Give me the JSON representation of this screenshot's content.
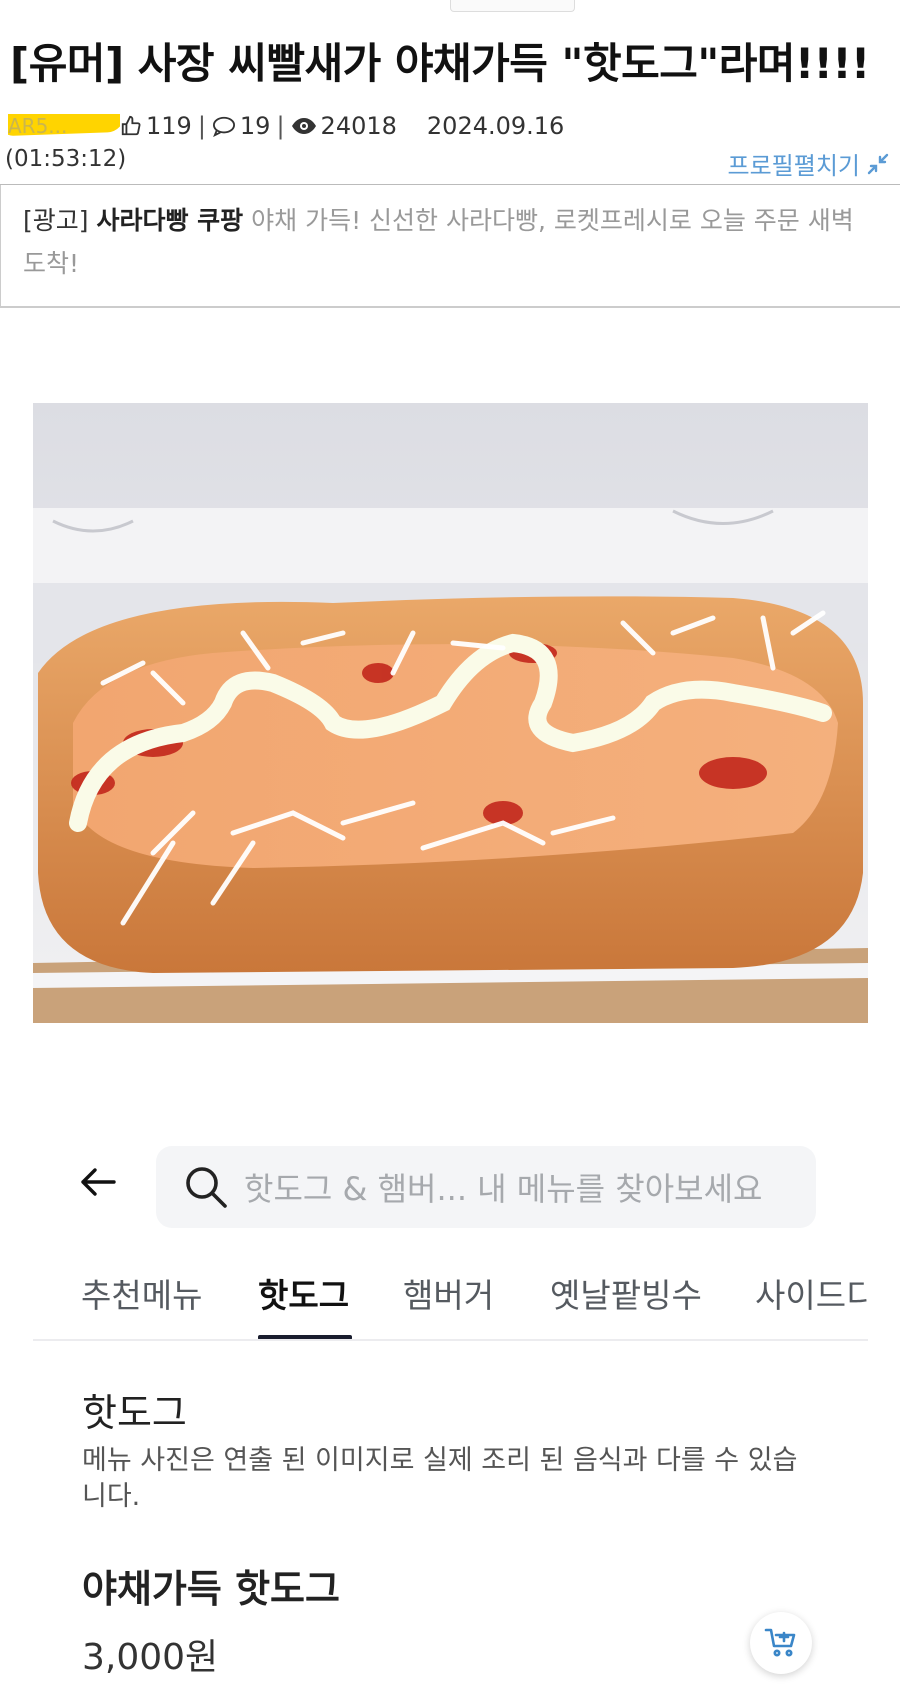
{
  "post": {
    "title": "[유머] 사장 씨빨새가 야채가득 \"핫도그\"라며!!!!",
    "author_redacted": "AR5...",
    "likes": "119",
    "comments": "19",
    "views": "24018",
    "date": "2024.09.16",
    "time": "(01:53:12)",
    "profile_toggle": "프로필펼치기",
    "highlight_color": "#ffd400"
  },
  "ad": {
    "tag": "[광고]",
    "name": "사라다빵 쿠팡",
    "text": "야채 가득! 신선한 사라다빵, 로켓프레시로 오늘 주문 새벽 도착!"
  },
  "menu_app": {
    "search_placeholder": "핫도그 & 햄버... 내 메뉴를 찾아보세요",
    "tabs": [
      "추천메뉴",
      "핫도그",
      "햄버거",
      "옛날팥빙수",
      "사이드디"
    ],
    "active_tab": "핫도그",
    "section_title": "핫도그",
    "notice": "메뉴 사진은 연출 된 이미지로 실제 조리 된 음식과 다를 수 있습니다.",
    "item_name": "야채가득 핫도그",
    "item_price": "3,000원"
  },
  "icons": {
    "like": "thumbs-up-icon",
    "comment": "speech-bubble-icon",
    "views": "eye-icon",
    "collapse": "collapse-arrows-icon",
    "back": "back-arrow-icon",
    "search": "search-icon",
    "cart": "add-to-cart-icon"
  }
}
